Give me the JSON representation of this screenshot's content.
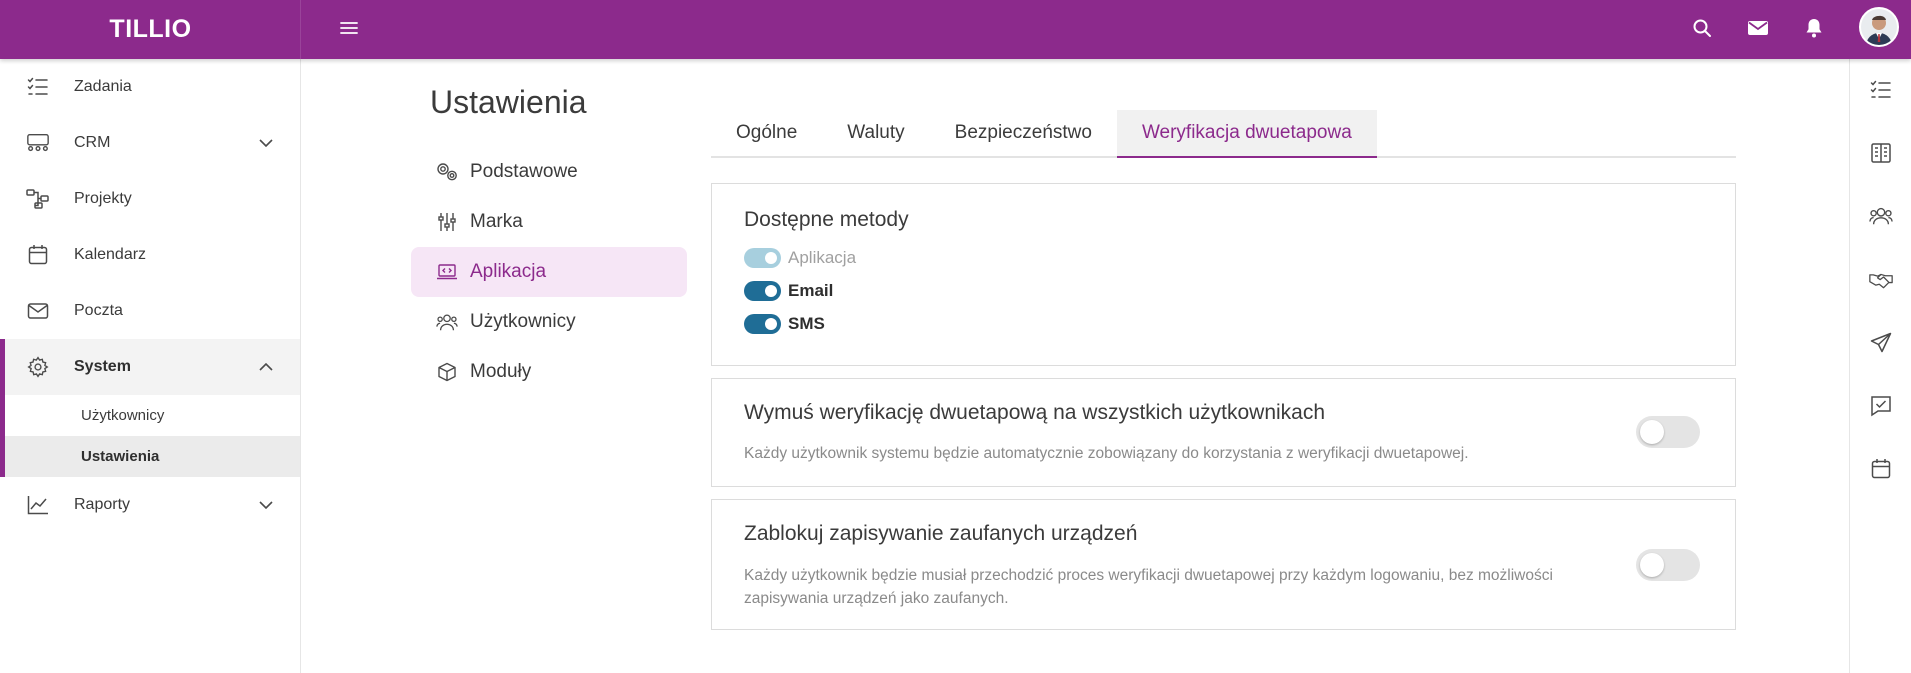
{
  "app": {
    "logo": "TILLIO"
  },
  "sidebar": {
    "items": [
      {
        "label": "Zadania",
        "icon": "tasks-icon"
      },
      {
        "label": "CRM",
        "icon": "crm-icon",
        "expandable": true
      },
      {
        "label": "Projekty",
        "icon": "projects-icon"
      },
      {
        "label": "Kalendarz",
        "icon": "calendar-icon"
      },
      {
        "label": "Poczta",
        "icon": "mail-icon"
      },
      {
        "label": "System",
        "icon": "gear-icon",
        "expanded": true,
        "active": true
      },
      {
        "label": "Raporty",
        "icon": "reports-icon",
        "expandable": true
      }
    ],
    "system_sub": [
      {
        "label": "Użytkownicy"
      },
      {
        "label": "Ustawienia",
        "selected": true
      }
    ]
  },
  "main": {
    "title": "Ustawienia",
    "settings_menu": [
      {
        "label": "Podstawowe",
        "icon": "gears-icon"
      },
      {
        "label": "Marka",
        "icon": "sliders-icon"
      },
      {
        "label": "Aplikacja",
        "icon": "laptop-code-icon",
        "active": true
      },
      {
        "label": "Użytkownicy",
        "icon": "users-icon"
      },
      {
        "label": "Moduły",
        "icon": "cube-icon"
      }
    ],
    "tabs": [
      {
        "label": "Ogólne"
      },
      {
        "label": "Waluty"
      },
      {
        "label": "Bezpieczeństwo"
      },
      {
        "label": "Weryfikacja dwuetapowa",
        "active": true
      }
    ],
    "methods_card": {
      "title": "Dostępne metody",
      "methods": [
        {
          "label": "Aplikacja",
          "enabled": true,
          "disabled": true
        },
        {
          "label": "Email",
          "enabled": true
        },
        {
          "label": "SMS",
          "enabled": true
        }
      ]
    },
    "force_card": {
      "title": "Wymuś weryfikację dwuetapową na wszystkich użytkownikach",
      "description": "Każdy użytkownik systemu będzie automatycznie zobowiązany do korzystania z weryfikacji dwuetapowej.",
      "enabled": false
    },
    "block_card": {
      "title": "Zablokuj zapisywanie zaufanych urządzeń",
      "description": "Każdy użytkownik będzie musiał przechodzić proces weryfikacji dwuetapowej przy każdym logowaniu, bez możliwości zapisywania urządzeń jako zaufanych.",
      "enabled": false
    }
  },
  "colors": {
    "brand": "#8c2a8c",
    "toggle_on": "#1f6d96",
    "toggle_disabled": "#a7cfde"
  }
}
